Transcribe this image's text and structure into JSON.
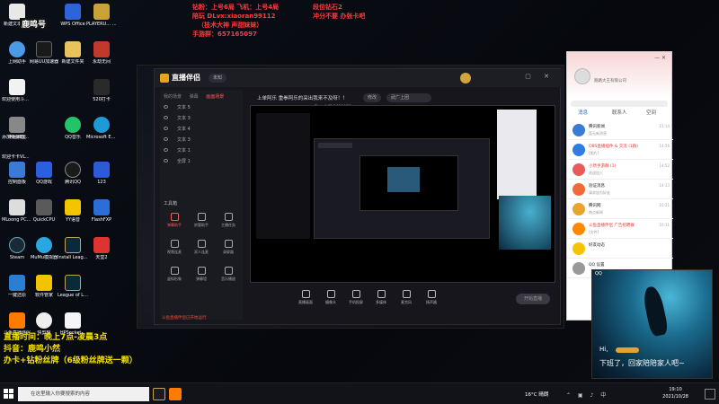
{
  "overlay": {
    "top_left_badge": "鹿鸣号",
    "top_line1": "钻粉：上号6局 飞机：上号4局",
    "top_line2": "陪玩 DLvx:xiaoran99112",
    "top_line3": "（技术大神 声甜妹妹）",
    "top_line4": "手游群：657165097",
    "top_right1": "段位钻石2",
    "top_right2": "冲分不要 办张卡吧",
    "bottom_line1": "直播时间：晚上7点-凌晨3点",
    "bottom_line2": "抖音：鹿鸣小然",
    "bottom_line3": "办卡+钻粉丝牌（6级粉丝牌送一颗）"
  },
  "desktop_icons": [
    {
      "label": "新建文本文档"
    },
    {
      "label": "WPS Office"
    },
    {
      "label": "PLAYERU... BATTLEGR..."
    },
    {
      "label": "上网助手"
    },
    {
      "label": "网易UU加速器"
    },
    {
      "label": "新建文件夹"
    },
    {
      "label": "永劫无间"
    },
    {
      "label": "欢迎使用斗鱼弹幕助手"
    },
    {
      "label": "丰区城堡"
    },
    {
      "label": "添加弹幕助手名"
    },
    {
      "label": "QQ音乐"
    },
    {
      "label": "520打卡"
    },
    {
      "label": "Microsoft Edge"
    },
    {
      "label": "欢迎卡卡VLV50"
    },
    {
      "label": "控制面板"
    },
    {
      "label": "QQ游戏"
    },
    {
      "label": "腾讯QQ"
    },
    {
      "label": "123"
    },
    {
      "label": "MLoong PC.exe"
    },
    {
      "label": "QuickCPU"
    },
    {
      "label": "YY语音"
    },
    {
      "label": "FlashFXP"
    },
    {
      "label": "Steam"
    },
    {
      "label": "MuMu模拟器"
    },
    {
      "label": "Install League..."
    },
    {
      "label": "天堂2"
    },
    {
      "label": "一键还原"
    },
    {
      "label": "软件管家"
    },
    {
      "label": "League of Legends"
    },
    {
      "label": "斗鱼直播伴侣"
    },
    {
      "label": "快剪辑"
    },
    {
      "label": "HPSocket..."
    }
  ],
  "streamer_app": {
    "brand": "直播伴侣",
    "status_pill": "未知",
    "live_title": "上单阿乐 重拳阿乐的采出我来不及呀！！",
    "edit_label": "修改",
    "category_label": "武广上团",
    "room_info": "Dy · 小然  1829933",
    "tabs": [
      "我的场景",
      "弹幕",
      "画面场景"
    ],
    "active_tab": "画面场景",
    "scene_items": [
      "文本 5",
      "文本 3",
      "文本 4",
      "文本 3",
      "文本 1",
      "全屏 1"
    ],
    "tools_header": "工具箱",
    "tools": [
      {
        "label": "弹幕助手",
        "hot": true
      },
      {
        "label": "房管助手",
        "hot": false
      },
      {
        "label": "主播任务",
        "hot": false
      },
      {
        "label": "视频连麦",
        "hot": false
      },
      {
        "label": "双人连麦",
        "hot": false
      },
      {
        "label": "录屏器",
        "hot": false
      },
      {
        "label": "虚拟形象",
        "hot": false
      },
      {
        "label": "弹幕墙",
        "hot": false
      },
      {
        "label": "音乐播放",
        "hot": false
      }
    ],
    "bottom_buttons": [
      "直播画面",
      "摄像头",
      "手机投屏",
      "多媒体",
      "麦克风",
      "扬声器"
    ],
    "start_button": "开始直播",
    "status_text": "斗鱼直播伴侣已开始运行"
  },
  "qq": {
    "nickname": "跑路大王有限公司",
    "tabs": [
      "消息",
      "联系人",
      "空间"
    ],
    "active_tab": "消息",
    "rows": [
      {
        "title": "腾讯新闻",
        "sub": "暂无新消息",
        "time": "15:14"
      },
      {
        "title": "OBS直播插件 & 交流 (1群)",
        "sub": "[图片]",
        "time": "14:56"
      },
      {
        "title": "小然手游群 (1)",
        "sub": "欢迎加入",
        "time": "14:52"
      },
      {
        "title": "验证消息",
        "sub": "请求加为好友",
        "time": "14:33"
      },
      {
        "title": "腾讯网",
        "sub": "热点新闻",
        "time": "10:21"
      },
      {
        "title": "斗鱼直播伴侣 广告招聘群",
        "sub": "[文件]",
        "time": "10:11"
      },
      {
        "title": "好友动态",
        "sub": "",
        "time": ""
      },
      {
        "title": "QQ 设置",
        "sub": "",
        "time": ""
      }
    ]
  },
  "cam": {
    "top": "QQ",
    "hi": "Hi,",
    "message": "下班了，回家陪陪家人吧~"
  },
  "taskbar": {
    "search_placeholder": "在这里输入你要搜索的内容",
    "weather": "16°C 晴朗",
    "time": "19:10",
    "date": "2021/10/28"
  }
}
